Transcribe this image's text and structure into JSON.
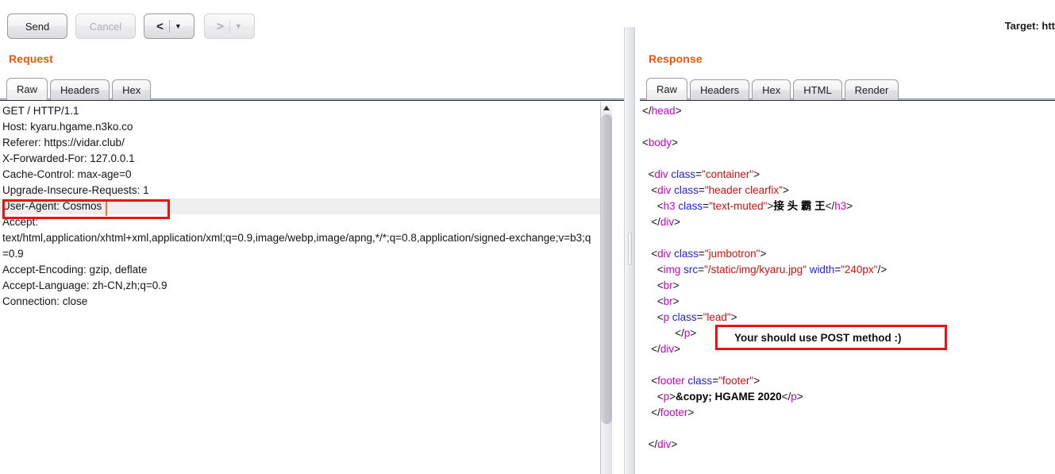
{
  "toolbar": {
    "send_label": "Send",
    "cancel_label": "Cancel",
    "back_arrow": "<",
    "forward_arrow": ">",
    "caret_glyph": "▼",
    "target_label": "Target: htt"
  },
  "request": {
    "title": "Request",
    "tabs": [
      {
        "label": "Raw",
        "active": true
      },
      {
        "label": "Headers",
        "active": false
      },
      {
        "label": "Hex",
        "active": false
      }
    ],
    "raw": "GET / HTTP/1.1\nHost: kyaru.hgame.n3ko.co\nReferer: https://vidar.club/\nX-Forwarded-For: 127.0.0.1\nCache-Control: max-age=0\nUpgrade-Insecure-Requests: 1\nUser-Agent: Cosmos\nAccept:\ntext/html,application/xhtml+xml,application/xml;q=0.9,image/webp,image/apng,*/*;q=0.8,application/signed-exchange;v=b3;q=0.9\nAccept-Encoding: gzip, deflate\nAccept-Language: zh-CN,zh;q=0.9\nConnection: close",
    "highlighted_line_text": "User-Agent: Cosmos"
  },
  "response": {
    "title": "Response",
    "tabs": [
      {
        "label": "Raw",
        "active": true
      },
      {
        "label": "Headers",
        "active": false
      },
      {
        "label": "Hex",
        "active": false
      },
      {
        "label": "HTML",
        "active": false
      },
      {
        "label": "Render",
        "active": false
      }
    ],
    "lines": [
      [
        {
          "t": "pun",
          "s": "</"
        },
        {
          "t": "tag",
          "s": "head"
        },
        {
          "t": "pun",
          "s": ">"
        }
      ],
      [],
      [
        {
          "t": "pun",
          "s": "<"
        },
        {
          "t": "tag",
          "s": "body"
        },
        {
          "t": "pun",
          "s": ">"
        }
      ],
      [],
      [
        {
          "t": "pun",
          "s": "  <"
        },
        {
          "t": "tag",
          "s": "div"
        },
        {
          "t": "attr",
          "s": " class"
        },
        {
          "t": "pun",
          "s": "="
        },
        {
          "t": "val",
          "s": "\"container\""
        },
        {
          "t": "pun",
          "s": ">"
        }
      ],
      [
        {
          "t": "pun",
          "s": "   <"
        },
        {
          "t": "tag",
          "s": "div"
        },
        {
          "t": "attr",
          "s": " class"
        },
        {
          "t": "pun",
          "s": "="
        },
        {
          "t": "val",
          "s": "\"header clearfix\""
        },
        {
          "t": "pun",
          "s": ">"
        }
      ],
      [
        {
          "t": "pun",
          "s": "     <"
        },
        {
          "t": "tag",
          "s": "h3"
        },
        {
          "t": "attr",
          "s": " class"
        },
        {
          "t": "pun",
          "s": "="
        },
        {
          "t": "val",
          "s": "\"text-muted\""
        },
        {
          "t": "pun",
          "s": ">"
        },
        {
          "t": "txt",
          "s": "接 头 霸 王"
        },
        {
          "t": "pun",
          "s": "</"
        },
        {
          "t": "tag",
          "s": "h3"
        },
        {
          "t": "pun",
          "s": ">"
        }
      ],
      [
        {
          "t": "pun",
          "s": "   </"
        },
        {
          "t": "tag",
          "s": "div"
        },
        {
          "t": "pun",
          "s": ">"
        }
      ],
      [],
      [
        {
          "t": "pun",
          "s": "   <"
        },
        {
          "t": "tag",
          "s": "div"
        },
        {
          "t": "attr",
          "s": " class"
        },
        {
          "t": "pun",
          "s": "="
        },
        {
          "t": "val",
          "s": "\"jumbotron\""
        },
        {
          "t": "pun",
          "s": ">"
        }
      ],
      [
        {
          "t": "pun",
          "s": "     <"
        },
        {
          "t": "tag",
          "s": "img"
        },
        {
          "t": "attr",
          "s": " src"
        },
        {
          "t": "pun",
          "s": "="
        },
        {
          "t": "val",
          "s": "\"/static/img/kyaru.jpg\""
        },
        {
          "t": "attr",
          "s": " width"
        },
        {
          "t": "pun",
          "s": "="
        },
        {
          "t": "val",
          "s": "\"240px\""
        },
        {
          "t": "pun",
          "s": "/>"
        }
      ],
      [
        {
          "t": "pun",
          "s": "     <"
        },
        {
          "t": "tag",
          "s": "br"
        },
        {
          "t": "pun",
          "s": ">"
        }
      ],
      [
        {
          "t": "pun",
          "s": "     <"
        },
        {
          "t": "tag",
          "s": "br"
        },
        {
          "t": "pun",
          "s": ">"
        }
      ],
      [
        {
          "t": "pun",
          "s": "     <"
        },
        {
          "t": "tag",
          "s": "p"
        },
        {
          "t": "attr",
          "s": " class"
        },
        {
          "t": "pun",
          "s": "="
        },
        {
          "t": "val",
          "s": "\"lead\""
        },
        {
          "t": "pun",
          "s": ">"
        }
      ],
      [
        {
          "t": "pun",
          "s": "           </"
        },
        {
          "t": "tag",
          "s": "p"
        },
        {
          "t": "pun",
          "s": ">"
        }
      ],
      [
        {
          "t": "pun",
          "s": "   </"
        },
        {
          "t": "tag",
          "s": "div"
        },
        {
          "t": "pun",
          "s": ">"
        }
      ],
      [],
      [
        {
          "t": "pun",
          "s": "   <"
        },
        {
          "t": "tag",
          "s": "footer"
        },
        {
          "t": "attr",
          "s": " class"
        },
        {
          "t": "pun",
          "s": "="
        },
        {
          "t": "val",
          "s": "\"footer\""
        },
        {
          "t": "pun",
          "s": ">"
        }
      ],
      [
        {
          "t": "pun",
          "s": "     <"
        },
        {
          "t": "tag",
          "s": "p"
        },
        {
          "t": "pun",
          "s": ">"
        },
        {
          "t": "txt",
          "s": "&copy; HGAME 2020"
        },
        {
          "t": "pun",
          "s": "</"
        },
        {
          "t": "tag",
          "s": "p"
        },
        {
          "t": "pun",
          "s": ">"
        }
      ],
      [
        {
          "t": "pun",
          "s": "   </"
        },
        {
          "t": "tag",
          "s": "footer"
        },
        {
          "t": "pun",
          "s": ">"
        }
      ],
      [],
      [
        {
          "t": "pun",
          "s": "  </"
        },
        {
          "t": "tag",
          "s": "div"
        },
        {
          "t": "pun",
          "s": ">"
        }
      ]
    ]
  },
  "annotations": {
    "user_agent_box_text": "User-Agent: Cosmos",
    "post_hint_text": "Your should use POST method :)"
  },
  "colors": {
    "accent_orange": "#e8590c",
    "annotation_red": "#ee1111",
    "tag_magenta": "#cc00cc",
    "attr_blue": "#2222dd",
    "value_red": "#d01111"
  }
}
